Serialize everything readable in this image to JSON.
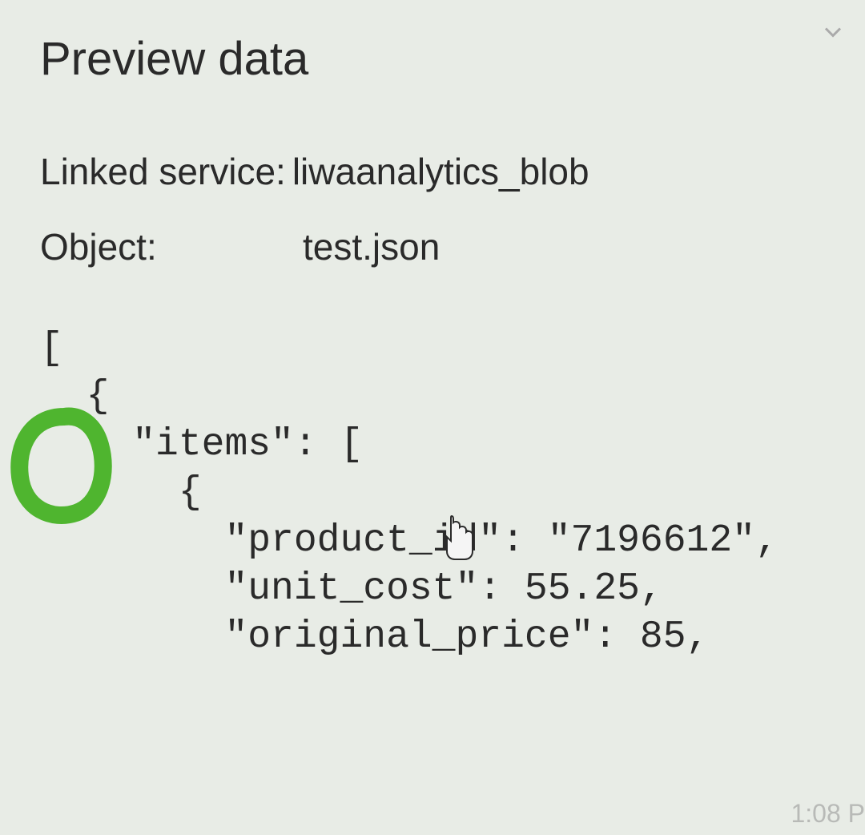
{
  "header": {
    "title": "Preview data"
  },
  "meta": {
    "linked_service_label": "Linked service:",
    "linked_service_value": "liwaanalytics_blob",
    "object_label": "Object:",
    "object_value": "test.json"
  },
  "code": {
    "line1": "[",
    "line2": "  {",
    "line3": "    \"items\": [",
    "line4": "      {",
    "line5": "        \"product_id\": \"7196612\",",
    "line6": "        \"unit_cost\": 55.25,",
    "line7": "        \"original_price\": 85,"
  },
  "overlay": {
    "clock": "1:08 P"
  }
}
